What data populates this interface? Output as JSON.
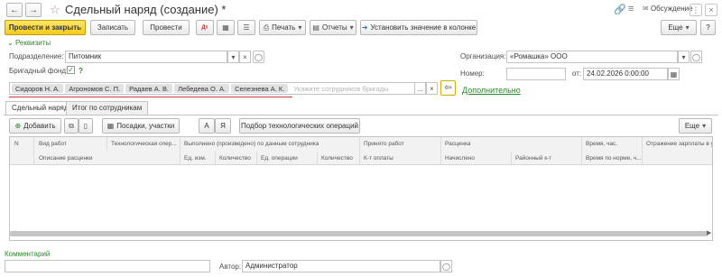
{
  "window": {
    "title": "Сдельный наряд (создание) *",
    "discussion_label": "Обсуждение"
  },
  "toolbar": {
    "post_close": "Провести и закрыть",
    "save": "Записать",
    "post": "Провести",
    "print": "Печать",
    "reports": "Отчеты",
    "set_value": "Установить значение в колонке",
    "more": "Еще"
  },
  "requisites": {
    "header": "Реквизиты",
    "department_label": "Подразделение:",
    "department_value": "Питомник",
    "brigade_fund_label": "Бригадный фонд:",
    "brigade_fund_help": "?",
    "organization_label": "Организация:",
    "organization_value": "«Ромашка» ООО",
    "number_label": "Номер:",
    "number_value": "",
    "date_label": "от:",
    "date_value": "24.02.2026  0:00:00",
    "additional_link": "Дополнительно"
  },
  "brigade": {
    "tags": [
      "Сидоров Н. А.",
      "Агрономов С. П.",
      "Радаев А. В.",
      "Лебедева О. А.",
      "Селезнева А. К."
    ],
    "placeholder": "Укажите сотрудников бригады"
  },
  "tabs": {
    "tab1": "Сдельный наряд",
    "tab2": "Итог по сотрудникам"
  },
  "table_toolbar": {
    "add": "Добавить",
    "plots": "Посадки, участки",
    "a1": "A",
    "a2": "Я",
    "pick_ops": "Подбор технологических операций",
    "more": "Еще"
  },
  "table": {
    "headers_row1": {
      "n": "N",
      "work_type": "Вид работ",
      "tech_op": "Технологическая опер...",
      "done": "Выполнено (произведено) по данным сотрудника",
      "accepted": "Принято работ",
      "rate": "Расценка",
      "time_h": "Время, час.",
      "salary_reflection": "Отражение зарплаты в у"
    },
    "headers_row2": {
      "rate_description": "Описание расценки",
      "unit": "Ед. изм.",
      "qty": "Количество",
      "op_unit": "Ед. операции",
      "op_qty": "Количество",
      "pay_coef": "К-т оплаты",
      "accrued": "Начислено",
      "district_coef": "Районный к-т",
      "time_norm": "Время по норме, ч..."
    }
  },
  "footer": {
    "comment_label": "Комментарий",
    "comment_value": "",
    "author_label": "Автор:",
    "author_value": "Администратор"
  }
}
